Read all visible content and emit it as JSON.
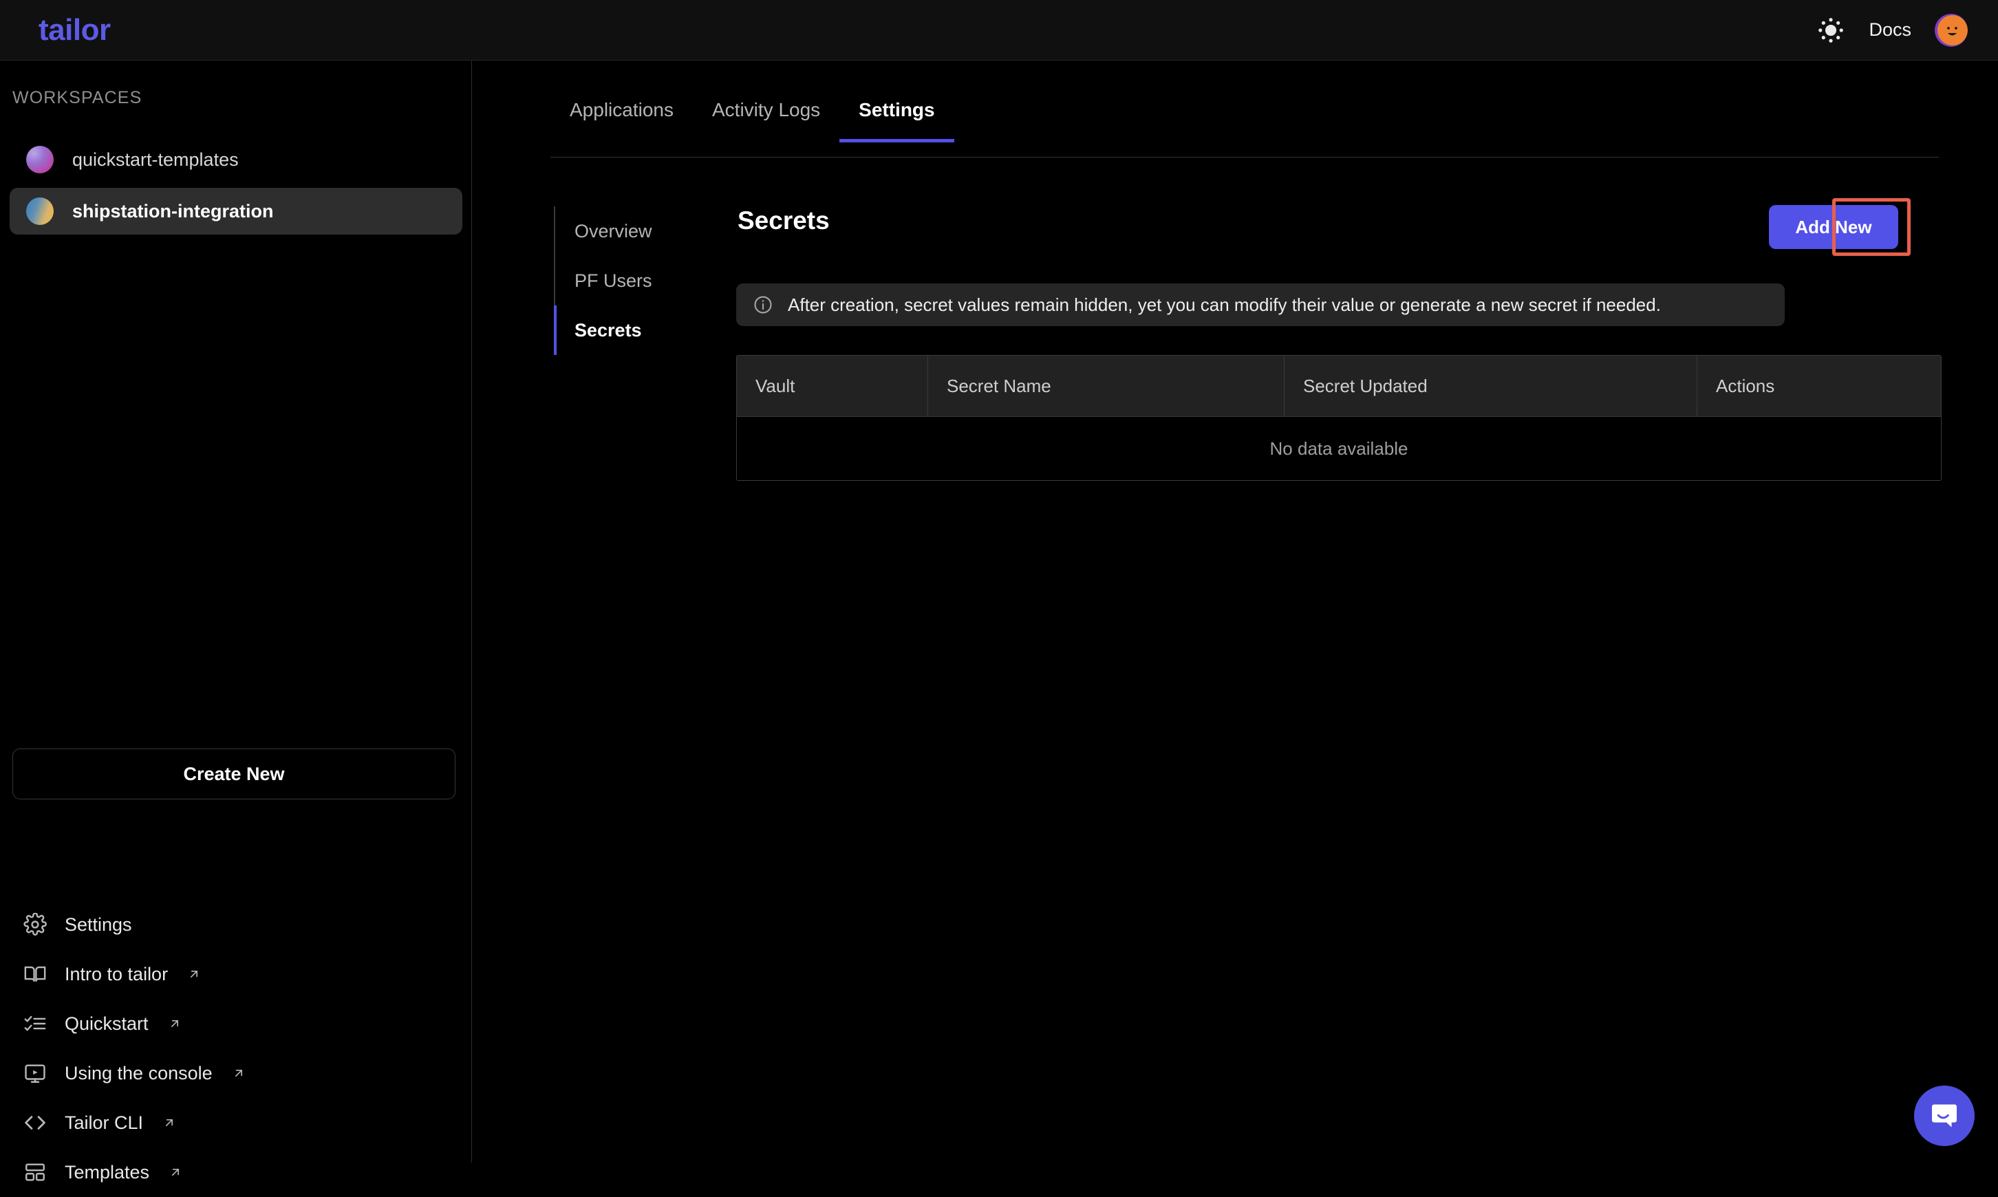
{
  "header": {
    "logo": "tailor",
    "docs_label": "Docs",
    "theme_icon": "sun-icon",
    "avatar_icon": "user-avatar",
    "background": "#101010",
    "logo_color": "#5d5ae6"
  },
  "sidebar": {
    "section_label": "WORKSPACES",
    "workspaces": [
      {
        "name": "quickstart-templates",
        "active": false,
        "avatar_from": "#b9a7e8",
        "avatar_to": "#cc2b8f"
      },
      {
        "name": "shipstation-integration",
        "active": true,
        "avatar_from": "#3b7fb5",
        "avatar_to": "#f0b951"
      }
    ],
    "create_new_label": "Create New",
    "links": [
      {
        "label": "Settings",
        "icon": "gear-icon",
        "external": false
      },
      {
        "label": "Intro to tailor",
        "icon": "book-icon",
        "external": true
      },
      {
        "label": "Quickstart",
        "icon": "checklist-icon",
        "external": true
      },
      {
        "label": "Using the console",
        "icon": "monitor-play-icon",
        "external": true
      },
      {
        "label": "Tailor CLI",
        "icon": "code-brackets-icon",
        "external": true
      },
      {
        "label": "Templates",
        "icon": "layout-grid-icon",
        "external": true
      }
    ]
  },
  "main": {
    "tabs": [
      {
        "label": "Applications",
        "active": false
      },
      {
        "label": "Activity Logs",
        "active": false
      },
      {
        "label": "Settings",
        "active": true
      }
    ],
    "subnav": [
      {
        "label": "Overview",
        "active": false
      },
      {
        "label": "PF Users",
        "active": false
      },
      {
        "label": "Secrets",
        "active": true
      }
    ],
    "page_title": "Secrets",
    "add_new_label": "Add New",
    "add_new_color": "#5251e8",
    "annotation_color": "#e8604c",
    "banner": {
      "icon": "info-circle-icon",
      "text": "After creation, secret values remain hidden, yet you can modify their value or generate a new secret if needed."
    },
    "table": {
      "columns": [
        "Vault",
        "Secret Name",
        "Secret Updated",
        "Actions"
      ],
      "rows": [],
      "empty_message": "No data available"
    }
  },
  "chat_widget": {
    "icon": "chat-bubble-icon",
    "color": "#4f4fe0"
  }
}
